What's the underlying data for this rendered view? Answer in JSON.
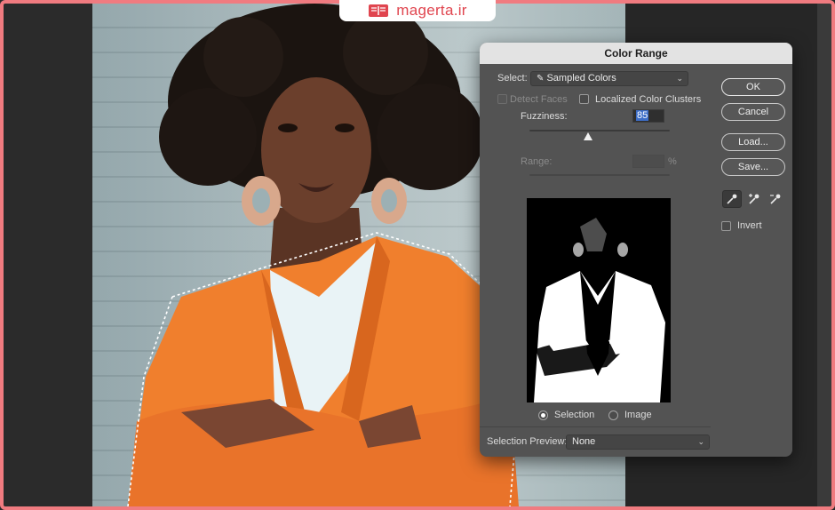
{
  "watermark": {
    "text": "magerta.ir",
    "color": "#e0454f"
  },
  "dialog": {
    "title": "Color Range",
    "select_label": "Select:",
    "select_value": "Sampled Colors",
    "detect_faces_label": "Detect Faces",
    "localized_label": "Localized Color Clusters",
    "fuzziness_label": "Fuzziness:",
    "fuzziness_value": "85",
    "fuzziness_level": 0.42,
    "range_label": "Range:",
    "range_unit": "%",
    "radio_selection": "Selection",
    "radio_image": "Image",
    "preview_label": "Selection Preview:",
    "preview_value": "None",
    "buttons": {
      "ok": "OK",
      "cancel": "Cancel",
      "load": "Load...",
      "save": "Save..."
    },
    "invert_label": "Invert",
    "tools": [
      "eyedropper-icon",
      "eyedropper-plus-icon",
      "eyedropper-minus-icon"
    ]
  },
  "colors": {
    "frame": "#f07b80",
    "dialog_bg": "#535353",
    "title_bg": "#e3e3e3",
    "highlight": "#3d6ec7",
    "jacket": "#f07f2d"
  }
}
